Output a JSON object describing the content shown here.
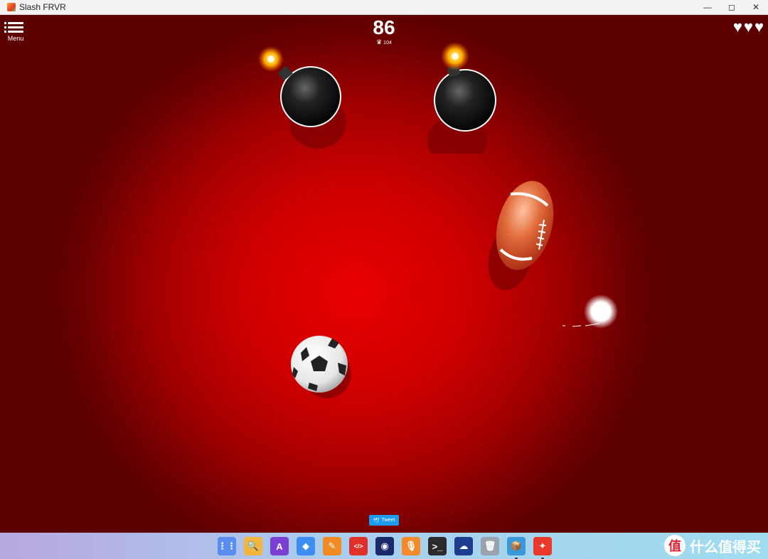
{
  "window": {
    "title": "Slash FRVR",
    "minimize": "—",
    "maximize": "◻",
    "close": "✕"
  },
  "hud": {
    "menu_label": "Menu",
    "score": "86",
    "best": "104",
    "lives": 3
  },
  "game_objects": [
    {
      "type": "bomb",
      "icon": "bomb-icon"
    },
    {
      "type": "bomb",
      "icon": "bomb-icon"
    },
    {
      "type": "american-football",
      "icon": "football-icon"
    },
    {
      "type": "blade-cursor",
      "icon": "glow-cursor-icon"
    },
    {
      "type": "soccer-ball",
      "icon": "soccer-ball-icon"
    }
  ],
  "tweet_button": {
    "label": "Tweet"
  },
  "dock": [
    {
      "name": "launcher-icon",
      "color": "#5b8def"
    },
    {
      "name": "file-manager-icon",
      "color": "#f2b63c"
    },
    {
      "name": "font-app-icon",
      "color": "#7a3fd0"
    },
    {
      "name": "cubes-app-icon",
      "color": "#3d8ef0"
    },
    {
      "name": "color-picker-icon",
      "color": "#f08a24"
    },
    {
      "name": "code-editor-icon",
      "color": "#e0302a"
    },
    {
      "name": "camera-app-icon",
      "color": "#1b2a6b"
    },
    {
      "name": "recorder-icon",
      "color": "#f58a2b"
    },
    {
      "name": "terminal-icon",
      "color": "#2b2b2b"
    },
    {
      "name": "network-app-icon",
      "color": "#1d3d8f"
    },
    {
      "name": "trash-icon",
      "color": "#9aa3ad"
    },
    {
      "name": "package-app-icon",
      "color": "#3a9ad9"
    },
    {
      "name": "slash-frvr-icon",
      "color": "#e8392b"
    }
  ],
  "watermark": {
    "text": "什么值得买",
    "logo_char": "值"
  }
}
